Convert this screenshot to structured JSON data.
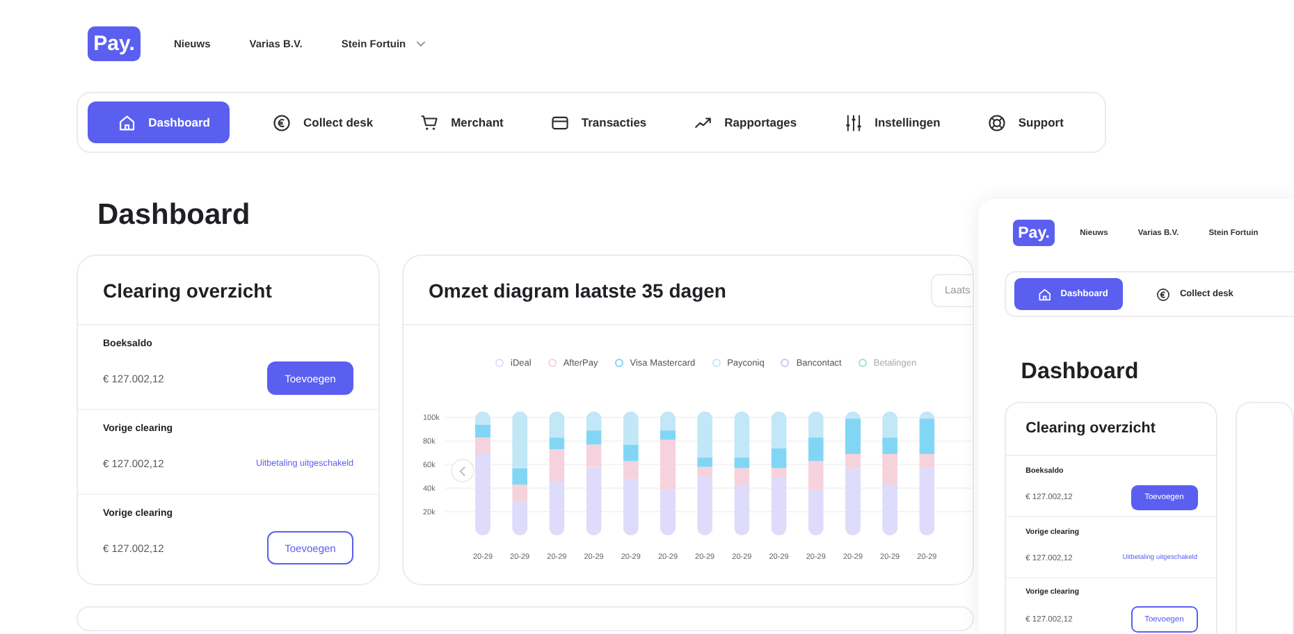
{
  "header": {
    "logo": "Pay.",
    "links": [
      "Nieuws",
      "Varias B.V."
    ],
    "user": "Stein Fortuin"
  },
  "nav": [
    {
      "label": "Dashboard",
      "selected": true
    },
    {
      "label": "Collect desk",
      "selected": false
    },
    {
      "label": "Merchant",
      "selected": false
    },
    {
      "label": "Transacties",
      "selected": false
    },
    {
      "label": "Rapportages",
      "selected": false
    },
    {
      "label": "Instellingen",
      "selected": false
    },
    {
      "label": "Support",
      "selected": false
    }
  ],
  "page_title": "Dashboard",
  "clearing": {
    "title": "Clearing overzicht",
    "rows": [
      {
        "label": "Boeksaldo",
        "amount": "€ 127.002,12",
        "action": {
          "kind": "button",
          "text": "Toevoegen"
        }
      },
      {
        "label": "Vorige clearing",
        "amount": "€ 127.002,12",
        "action": {
          "kind": "link",
          "text": "Uitbetaling uitgeschakeld"
        }
      },
      {
        "label": "Vorige clearing",
        "amount": "€ 127.002,12",
        "action": {
          "kind": "outline-button",
          "text": "Toevoegen"
        }
      }
    ]
  },
  "revenue": {
    "title": "Omzet diagram laatste 35 dagen",
    "period": "Laats",
    "legend_extra": [
      {
        "label": "Bancontact",
        "color": "#c4c6f5"
      },
      {
        "label": "Betalingen",
        "color": "#9fe0c4"
      }
    ],
    "chart_data": {
      "type": "bar",
      "stacked": true,
      "grid": true,
      "categories": [
        "20-29",
        "20-29",
        "20-29",
        "20-29",
        "20-29",
        "20-29",
        "20-29",
        "20-29",
        "20-29",
        "20-29",
        "20-29",
        "20-29",
        "20-29"
      ],
      "ylim": [
        0,
        105
      ],
      "yticks": [
        {
          "value": 20,
          "label": "20k"
        },
        {
          "value": 40,
          "label": "40k"
        },
        {
          "value": 60,
          "label": "60k"
        },
        {
          "value": 80,
          "label": "80k"
        },
        {
          "value": 100,
          "label": "100k"
        }
      ],
      "series": [
        {
          "name": "iDeal",
          "color": "#dedcfa",
          "values": [
            69,
            29,
            46,
            58,
            48,
            39,
            50,
            43,
            49,
            39,
            57,
            43,
            57
          ]
        },
        {
          "name": "AfterPay",
          "color": "#f6d2dd",
          "values": [
            14,
            14,
            27,
            19,
            15,
            42,
            8,
            14,
            8,
            24,
            12,
            26,
            12
          ]
        },
        {
          "name": "Visa Mastercard",
          "color": "#82d6f5",
          "values": [
            11,
            14,
            10,
            12,
            14,
            8,
            8,
            9,
            17,
            20,
            30,
            14,
            30
          ]
        },
        {
          "name": "Payconiq",
          "color": "#c2e7f6",
          "values": [
            11,
            48,
            22,
            16,
            28,
            16,
            39,
            39,
            31,
            22,
            6,
            22,
            6
          ]
        }
      ]
    }
  },
  "preview": {
    "header": {
      "logo": "Pay.",
      "links": [
        "Nieuws",
        "Varias B.V."
      ],
      "user": "Stein Fortuin"
    },
    "nav": [
      {
        "label": "Dashboard",
        "selected": true
      },
      {
        "label": "Collect desk",
        "selected": false
      }
    ],
    "page_title": "Dashboard",
    "clearing": {
      "title": "Clearing overzicht",
      "rows": [
        {
          "label": "Boeksaldo",
          "amount": "€ 127.002,12",
          "action": {
            "kind": "button",
            "text": "Toevoegen"
          }
        },
        {
          "label": "Vorige clearing",
          "amount": "€ 127.002,12",
          "action": {
            "kind": "link",
            "text": "Uitbetaling uitgeschakeld"
          }
        },
        {
          "label": "Vorige clearing",
          "amount": "€ 127.002,12",
          "action": {
            "kind": "outline-button",
            "text": "Toevoegen"
          }
        }
      ]
    }
  }
}
